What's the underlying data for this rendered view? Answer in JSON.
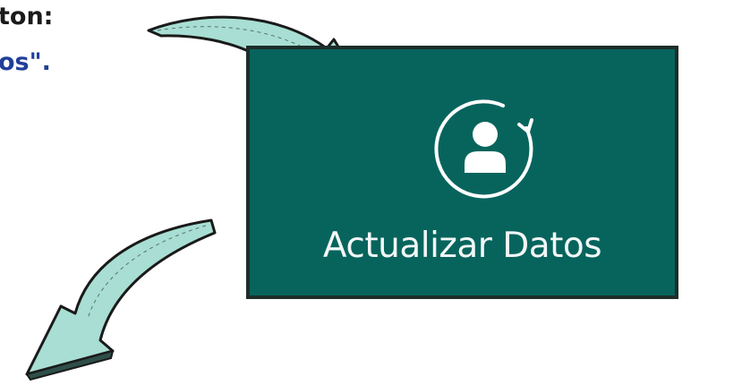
{
  "instructions": {
    "line1": "ton:",
    "line2": "os\"."
  },
  "update_button": {
    "label": "Actualizar Datos",
    "icon": "user-refresh-icon",
    "background": "#07645d"
  },
  "arrows": {
    "fill": "#a8ded3",
    "stroke": "#1a1a1a"
  }
}
